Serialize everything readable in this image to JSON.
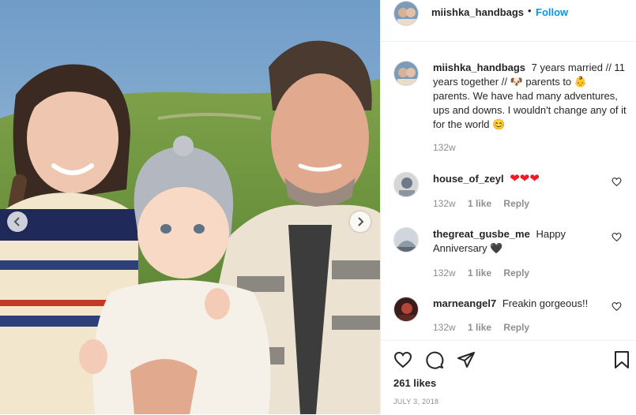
{
  "post": {
    "username": "miishka_handbags",
    "follow_label": "Follow",
    "dot": "•",
    "caption_text": "7 years married // 11 years together // 🐶 parents to 👶 parents. We have had many adventures, ups and downs. I wouldn't change any of it for the world 😊",
    "caption_time": "132w",
    "likes": "261 likes",
    "date": "JULY 3, 2018"
  },
  "comments": [
    {
      "username": "house_of_zeyl",
      "text": "❤❤❤",
      "time": "132w",
      "likes": "1 like",
      "reply": "Reply"
    },
    {
      "username": "thegreat_gusbe_me",
      "text": "Happy Anniversary 🖤",
      "time": "132w",
      "likes": "1 like",
      "reply": "Reply"
    },
    {
      "username": "marneangel7",
      "text": "Freakin gorgeous!!",
      "time": "132w",
      "likes": "1 like",
      "reply": "Reply"
    }
  ],
  "icons": {
    "like": "heart-outline-icon",
    "comment": "comment-bubble-icon",
    "share": "paper-plane-icon",
    "save": "bookmark-icon",
    "prev": "chevron-left-icon",
    "next": "chevron-right-icon"
  },
  "colors": {
    "follow": "#0095f6",
    "secondary_text": "#8e8e8e",
    "divider": "#efefef"
  }
}
